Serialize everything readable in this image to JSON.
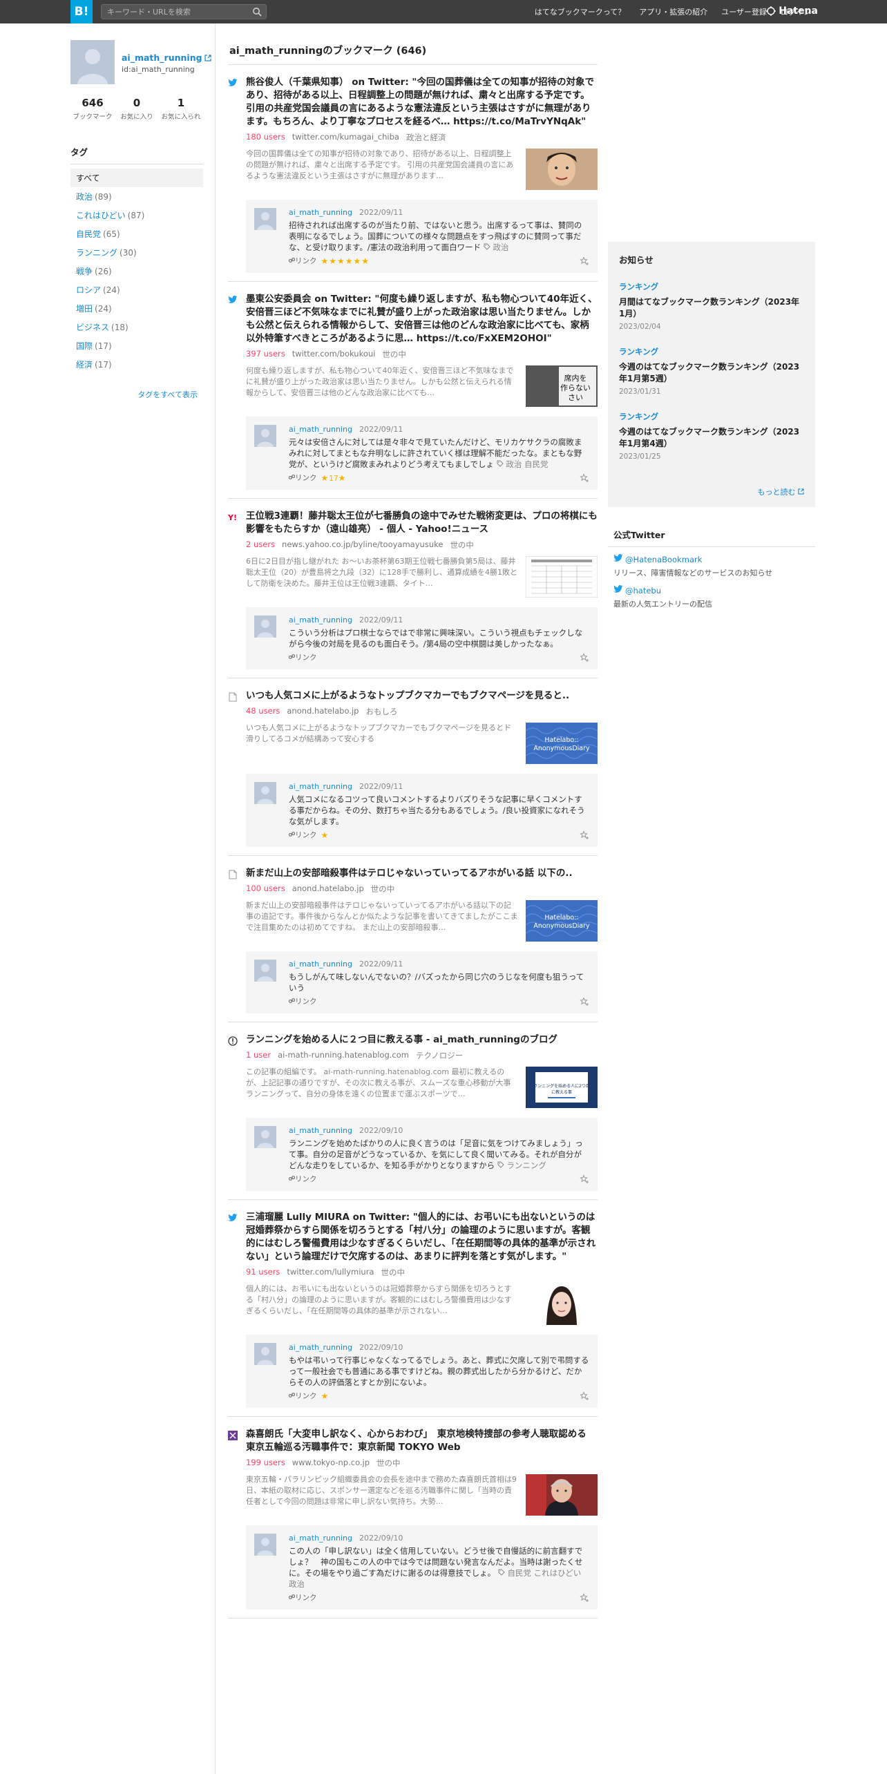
{
  "header": {
    "logo": "B!",
    "search_placeholder": "キーワード・URLを検索",
    "links": [
      "はてなブックマークって？",
      "アプリ・拡張の紹介",
      "ユーザー登録",
      "ログイン"
    ],
    "brand": "Hatena"
  },
  "profile": {
    "name": "ai_math_running",
    "id": "id:ai_math_running",
    "stats": [
      {
        "num": "646",
        "label": "ブックマーク"
      },
      {
        "num": "0",
        "label": "お気に入り"
      },
      {
        "num": "1",
        "label": "お気に入られ"
      }
    ]
  },
  "tags": {
    "heading": "タグ",
    "all": "すべて",
    "items": [
      {
        "name": "政治",
        "count": "(89)"
      },
      {
        "name": "これはひどい",
        "count": "(87)"
      },
      {
        "name": "自民党",
        "count": "(65)"
      },
      {
        "name": "ランニング",
        "count": "(30)"
      },
      {
        "name": "戦争",
        "count": "(26)"
      },
      {
        "name": "ロシア",
        "count": "(24)"
      },
      {
        "name": "増田",
        "count": "(24)"
      },
      {
        "name": "ビジネス",
        "count": "(18)"
      },
      {
        "name": "国際",
        "count": "(17)"
      },
      {
        "name": "経済",
        "count": "(17)"
      }
    ],
    "show_all": "タグをすべて表示"
  },
  "main": {
    "heading": "ai_math_runningのブックマーク (646)",
    "entries": [
      {
        "favicon": "twitter",
        "title": "熊谷俊人（千葉県知事） on Twitter: \"今回の国葬儀は全ての知事が招待の対象であり、招待がある以上、日程調整上の問題が無ければ、粛々と出席する予定です。 引用の共産党国会議員の言にあるような憲法違反という主張はさすがに無理があります。もちろん、より丁寧なプロセスを経るべ… https://t.co/MaTrvYNqAk\"",
        "users": "180 users",
        "domain": "twitter.com/kumagai_chiba",
        "category": "政治と経済",
        "summary": "今回の国葬儀は全ての知事が招待の対象であり、招待がある以上、日程調整上の問題が無ければ、粛々と出席する予定です。 引用の共産党国会議員の言にあるような憲法違反という主張はさすがに無理があります…",
        "thumb": "person",
        "user": "ai_math_running",
        "date": "2022/09/11",
        "comment": "招待されれば出席するのが当たり前、ではないと思う。出席するって事は、賛同の表明になるでしょう。国葬についての様々な問題点をすっ飛ばすのに賛同って事だな、と受け取ります。/憲法の政治利用って面白ワード",
        "tags": "政治",
        "link_label": "リンク",
        "stars": "★★★★★★",
        "star_count": ""
      },
      {
        "favicon": "twitter",
        "title": "墨東公安委員会 on Twitter: \"何度も繰り返しますが、私も物心ついて40年近く、安倍晋三ほど不気味なまでに礼賛が盛り上がった政治家は思い当たりません。しかも公然と伝えられる情報からして、安倍晋三は他のどんな政治家に比べても、家柄以外特筆すべきところがあるように思… https://t.co/FxXEM2OHOI\"",
        "users": "397 users",
        "domain": "twitter.com/bokukoui",
        "category": "世の中",
        "summary": "何度も繰り返しますが、私も物心ついて40年近く、安倍晋三ほど不気味なまでに礼賛が盛り上がった政治家は思い当たりません。しかも公然と伝えられる情報からして、安倍晋三は他のどんな政治家に比べても…",
        "thumb": "sign",
        "user": "ai_math_running",
        "date": "2022/09/11",
        "comment": "元々は安倍さんに対しては是々非々で見ていたんだけど、モリカケサクラの腐敗まみれに対してまともな弁明なしに許されていく様は理解不能だったな。まともな野党が、というけど腐敗まみれよりどう考えてもましでしょ",
        "tags": "政治 自民党",
        "link_label": "リンク",
        "stars": "★",
        "star_count": "17"
      },
      {
        "favicon": "yahoo",
        "title": "王位戦3連覇！藤井聡太王位が七番勝負の途中でみせた戦術変更は、プロの将棋にも影響をもたらすか（遠山雄亮） - 個人 - Yahoo!ニュース",
        "users": "2 users",
        "domain": "news.yahoo.co.jp/byline/tooyamayusuke",
        "category": "世の中",
        "summary": "6日に2日目が指し継がれた お～いお茶杯第63期王位戦七番勝負第5局は、藤井聡太王位（20）が豊島将之九段（32）に128手で勝利し、通算成績を4勝1敗として防衛を決めた。藤井王位は王位戦3連覇、タイト…",
        "thumb": "table",
        "user": "ai_math_running",
        "date": "2022/09/11",
        "comment": "こういう分析はプロ棋士ならではで非常に興味深い。こういう視点もチェックしながら今後の対局を見るのも面白そう。/第4局の空中棋闘は美しかったなぁ。",
        "tags": "",
        "link_label": "リンク",
        "stars": "",
        "star_count": ""
      },
      {
        "favicon": "doc",
        "title": "いつも人気コメに上がるようなトップブクマカーでもブクマページを見ると..",
        "users": "48 users",
        "domain": "anond.hatelabo.jp",
        "category": "おもしろ",
        "summary": "いつも人気コメに上がるようなトップブクマカーでもブクマページを見るとド滑りしてるコメが結構あって安心する",
        "thumb": "anond",
        "user": "ai_math_running",
        "date": "2022/09/11",
        "comment": "人気コメになるコツって良いコメントするよりバズりそうな記事に早くコメントする事だからね。その分、数打ちゃ当たる分もあるでしょう。/良い投資家になれそうな気がします。",
        "tags": "",
        "link_label": "リンク",
        "stars": "★",
        "star_count": ""
      },
      {
        "favicon": "doc",
        "title": "新まだ山上の安部暗殺事件はテロじゃないっていってるアホがいる話 以下の..",
        "users": "100 users",
        "domain": "anond.hatelabo.jp",
        "category": "世の中",
        "summary": "新まだ山上の安部暗殺事件はテロじゃないっていってるアホがいる話以下の記事の追記です。事件後からなんとか似たような記事を書いてきてましたがここまで注目集めたのは初めてですね。 まだ山上の安部暗殺事…",
        "thumb": "anond",
        "user": "ai_math_running",
        "date": "2022/09/11",
        "comment": "もうしがんて味しないんでないの？/バズったから同じ穴のうじなを何度も狙うっていう",
        "tags": "",
        "link_label": "リンク",
        "stars": "",
        "star_count": ""
      },
      {
        "favicon": "blog",
        "title": "ランニングを始める人に２つ目に教える事 - ai_math_runningのブログ",
        "users": "1 user",
        "domain": "ai-math-running.hatenablog.com",
        "category": "テクノロジー",
        "summary": "この記事の組編です。 ai-math-running.hatenablog.com 最初に教えるのが、上記記事の通りですが、その次に教える事が、スムーズな重心移動が大事 ランニングって、自分の身体を遠くの位置まで運ぶスポーツで…",
        "thumb": "blog",
        "user": "ai_math_running",
        "date": "2022/09/10",
        "comment": "ランニングを始めたばかりの人に良く言うのは「足音に気をつけてみましょう」って事。自分の足音がどうなっているか、を気にして良く聞いてみる。それが自分がどんな走りをしているか、を知る手がかりとなりますから",
        "tags": "ランニング",
        "link_label": "リンク",
        "stars": "",
        "star_count": ""
      },
      {
        "favicon": "twitter",
        "title": "三浦瑠麗 Lully MIURA on Twitter: \"個人的には、お弔いにも出ないというのは冠婚葬祭からすら関係を切ろうとする「村八分」の論理のように思いますが。客観的にはむしろ警備費用は少なすぎるくらいだし、「在任期間等の具体的基準が示されない」という論理だけで欠席するのは、あまりに評判を落とす気がします。\"",
        "users": "91 users",
        "domain": "twitter.com/lullymiura",
        "category": "世の中",
        "summary": "個人的には、お弔いにも出ないというのは冠婚葬祭からすら関係を切ろうとする「村八分」の論理のように思いますが。客観的にはむしろ警備費用は少なすぎるくらいだし、「在任期間等の具体的基準が示されない…",
        "thumb": "woman",
        "user": "ai_math_running",
        "date": "2022/09/10",
        "comment": "もやは弔いって行事じゃなくなってるでしょう。あと、葬式に欠席して別で弔問するって一般社会でも普通にある事ですけどね。親の葬式出したから分かるけど、だからその人の評価落とすとか別にないよ。",
        "tags": "",
        "link_label": "リンク",
        "stars": "★",
        "star_count": ""
      },
      {
        "favicon": "tokyo",
        "title": "森喜朗氏「大変申し訳なく、心からおわび」　東京地検特捜部の参考人聴取認める　東京五輪巡る汚職事件で：東京新聞 TOKYO Web",
        "users": "199 users",
        "domain": "www.tokyo-np.co.jp",
        "category": "世の中",
        "summary": "東京五輪・パラリンピック組織委員会の会長を途中まで務めた森喜朗氏首相は9日、本紙の取材に応じ、スポンサー選定などを巡る汚職事件に関し「当時の責任者として今回の問題は非常に申し訳ない気持ち。大勢…",
        "thumb": "oldman",
        "user": "ai_math_running",
        "date": "2022/09/10",
        "comment": "この人の「申し訳ない」は全く信用していない。どうせ後で自慢話的に前言翻すでしょ？　神の国もこの人の中では今では問題ない発言なんだよ。当時は謝ったくせに。その場をやり過ごす為だけに謝るのは得意技でしょ。",
        "tags": "自民党 これはひどい 政治",
        "link_label": "リンク",
        "stars": "",
        "star_count": ""
      }
    ]
  },
  "notice": {
    "heading": "お知らせ",
    "items": [
      {
        "category": "ランキング",
        "title": "月間はてなブックマーク数ランキング（2023年1月）",
        "date": "2023/02/04"
      },
      {
        "category": "ランキング",
        "title": "今週のはてなブックマーク数ランキング（2023年1月第5週）",
        "date": "2023/01/31"
      },
      {
        "category": "ランキング",
        "title": "今週のはてなブックマーク数ランキング（2023年1月第4週）",
        "date": "2023/01/25"
      }
    ],
    "more": "もっと読む"
  },
  "official_twitter": {
    "heading": "公式Twitter",
    "items": [
      {
        "name": "@HatenaBookmark",
        "desc": "リリース、障害情報などのサービスのお知らせ"
      },
      {
        "name": "@hatebu",
        "desc": "最新の人気エントリーの配信"
      }
    ]
  },
  "colors": {
    "header_bg": "#3e3e3e",
    "logo_bg": "#00a4de",
    "link": "#1a8ad2",
    "users": "#ff4166",
    "star": "#f4b400"
  }
}
